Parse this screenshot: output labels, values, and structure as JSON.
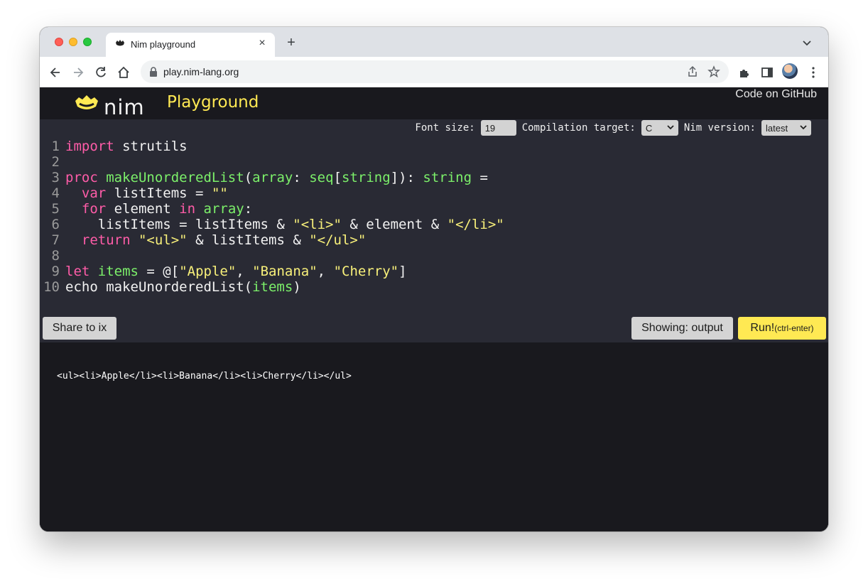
{
  "browser": {
    "tab": {
      "title": "Nim playground",
      "close": "×"
    },
    "new_tab": "+",
    "url": "play.nim-lang.org"
  },
  "navbar": {
    "logo_text": "nim",
    "title": "Playground",
    "github_link": "Code on GitHub"
  },
  "settings": {
    "font_size_label": "Font size:",
    "font_size_value": "19",
    "target_label": "Compilation target:",
    "target_value": "C",
    "version_label": "Nim version:",
    "version_value": "latest"
  },
  "code": {
    "lines": [
      {
        "n": "1",
        "tokens": [
          {
            "t": "kw",
            "v": "import"
          },
          {
            "t": "",
            "v": " strutils"
          }
        ]
      },
      {
        "n": "2",
        "tokens": []
      },
      {
        "n": "3",
        "tokens": [
          {
            "t": "kw",
            "v": "proc"
          },
          {
            "t": "",
            "v": " "
          },
          {
            "t": "fn",
            "v": "makeUnorderedList"
          },
          {
            "t": "",
            "v": "("
          },
          {
            "t": "ty",
            "v": "array"
          },
          {
            "t": "",
            "v": ": "
          },
          {
            "t": "ty",
            "v": "seq"
          },
          {
            "t": "",
            "v": "["
          },
          {
            "t": "ty",
            "v": "string"
          },
          {
            "t": "",
            "v": "]): "
          },
          {
            "t": "ty",
            "v": "string"
          },
          {
            "t": "",
            "v": " ="
          }
        ]
      },
      {
        "n": "4",
        "tokens": [
          {
            "t": "",
            "v": "  "
          },
          {
            "t": "kw",
            "v": "var"
          },
          {
            "t": "",
            "v": " listItems = "
          },
          {
            "t": "str",
            "v": "\"\""
          }
        ]
      },
      {
        "n": "5",
        "tokens": [
          {
            "t": "",
            "v": "  "
          },
          {
            "t": "kw",
            "v": "for"
          },
          {
            "t": "",
            "v": " element "
          },
          {
            "t": "kw",
            "v": "in"
          },
          {
            "t": "",
            "v": " "
          },
          {
            "t": "ty",
            "v": "array"
          },
          {
            "t": "",
            "v": ":"
          }
        ]
      },
      {
        "n": "6",
        "tokens": [
          {
            "t": "",
            "v": "    listItems = listItems & "
          },
          {
            "t": "str",
            "v": "\"<li>\""
          },
          {
            "t": "",
            "v": " & element & "
          },
          {
            "t": "str",
            "v": "\"</li>\""
          }
        ]
      },
      {
        "n": "7",
        "tokens": [
          {
            "t": "",
            "v": "  "
          },
          {
            "t": "kw",
            "v": "return"
          },
          {
            "t": "",
            "v": " "
          },
          {
            "t": "str",
            "v": "\"<ul>\""
          },
          {
            "t": "",
            "v": " & listItems & "
          },
          {
            "t": "str",
            "v": "\"</ul>\""
          }
        ]
      },
      {
        "n": "8",
        "tokens": []
      },
      {
        "n": "9",
        "tokens": [
          {
            "t": "kw",
            "v": "let"
          },
          {
            "t": "",
            "v": " "
          },
          {
            "t": "ty",
            "v": "items"
          },
          {
            "t": "",
            "v": " = @["
          },
          {
            "t": "str",
            "v": "\"Apple\""
          },
          {
            "t": "",
            "v": ", "
          },
          {
            "t": "str",
            "v": "\"Banana\""
          },
          {
            "t": "",
            "v": ", "
          },
          {
            "t": "str",
            "v": "\"Cherry\""
          },
          {
            "t": "",
            "v": "]"
          }
        ]
      },
      {
        "n": "10",
        "tokens": [
          {
            "t": "",
            "v": "echo makeUnorderedList("
          },
          {
            "t": "ty",
            "v": "items"
          },
          {
            "t": "",
            "v": ")"
          }
        ]
      }
    ]
  },
  "actions": {
    "share_label": "Share to ix",
    "showing_label": "Showing: output",
    "run_label": "Run!",
    "run_hint": "(ctrl-enter)"
  },
  "output": {
    "text": "<ul><li>Apple</li><li>Banana</li><li>Cherry</li></ul>"
  },
  "colors": {
    "accent_yellow": "#ffe953",
    "keyword": "#ff5ca8",
    "identifier": "#7cf06a",
    "string": "#f8f07a"
  },
  "icons": [
    "back-icon",
    "forward-icon",
    "reload-icon",
    "home-icon",
    "lock-icon",
    "share-icon",
    "star-icon",
    "extensions-icon",
    "sidepanel-icon",
    "menu-dots-icon",
    "tab-search-icon"
  ]
}
